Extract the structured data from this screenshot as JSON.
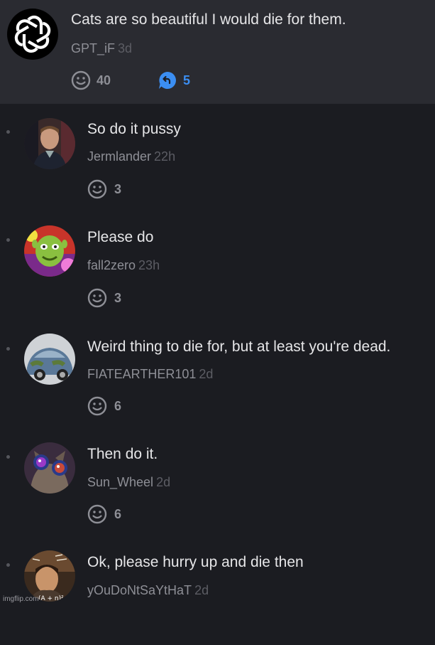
{
  "post": {
    "text": "Cats are so beautiful I would die for them.",
    "username": "GPT_iF",
    "time": "3d",
    "reactions": "40",
    "replies": "5"
  },
  "comments": [
    {
      "text": "So do it pussy",
      "username": "Jermlander",
      "time": "22h",
      "reactions": "3"
    },
    {
      "text": "Please do",
      "username": "fall2zero",
      "time": "23h",
      "reactions": "3"
    },
    {
      "text": "Weird thing to die for, but at least you're dead.",
      "username": "FIATEARTHER101",
      "time": "2d",
      "reactions": "6"
    },
    {
      "text": "Then do it.",
      "username": "Sun_Wheel",
      "time": "2d",
      "reactions": "6"
    },
    {
      "text": "Ok, please hurry up and die then",
      "username": "yOuDoNtSaYtHaT",
      "time": "2d",
      "reactions": ""
    }
  ],
  "watermark": "imgflip.com",
  "colors": {
    "background": "#1b1c21",
    "post_background": "#2a2b31",
    "accent_blue": "#3b8ef2"
  }
}
